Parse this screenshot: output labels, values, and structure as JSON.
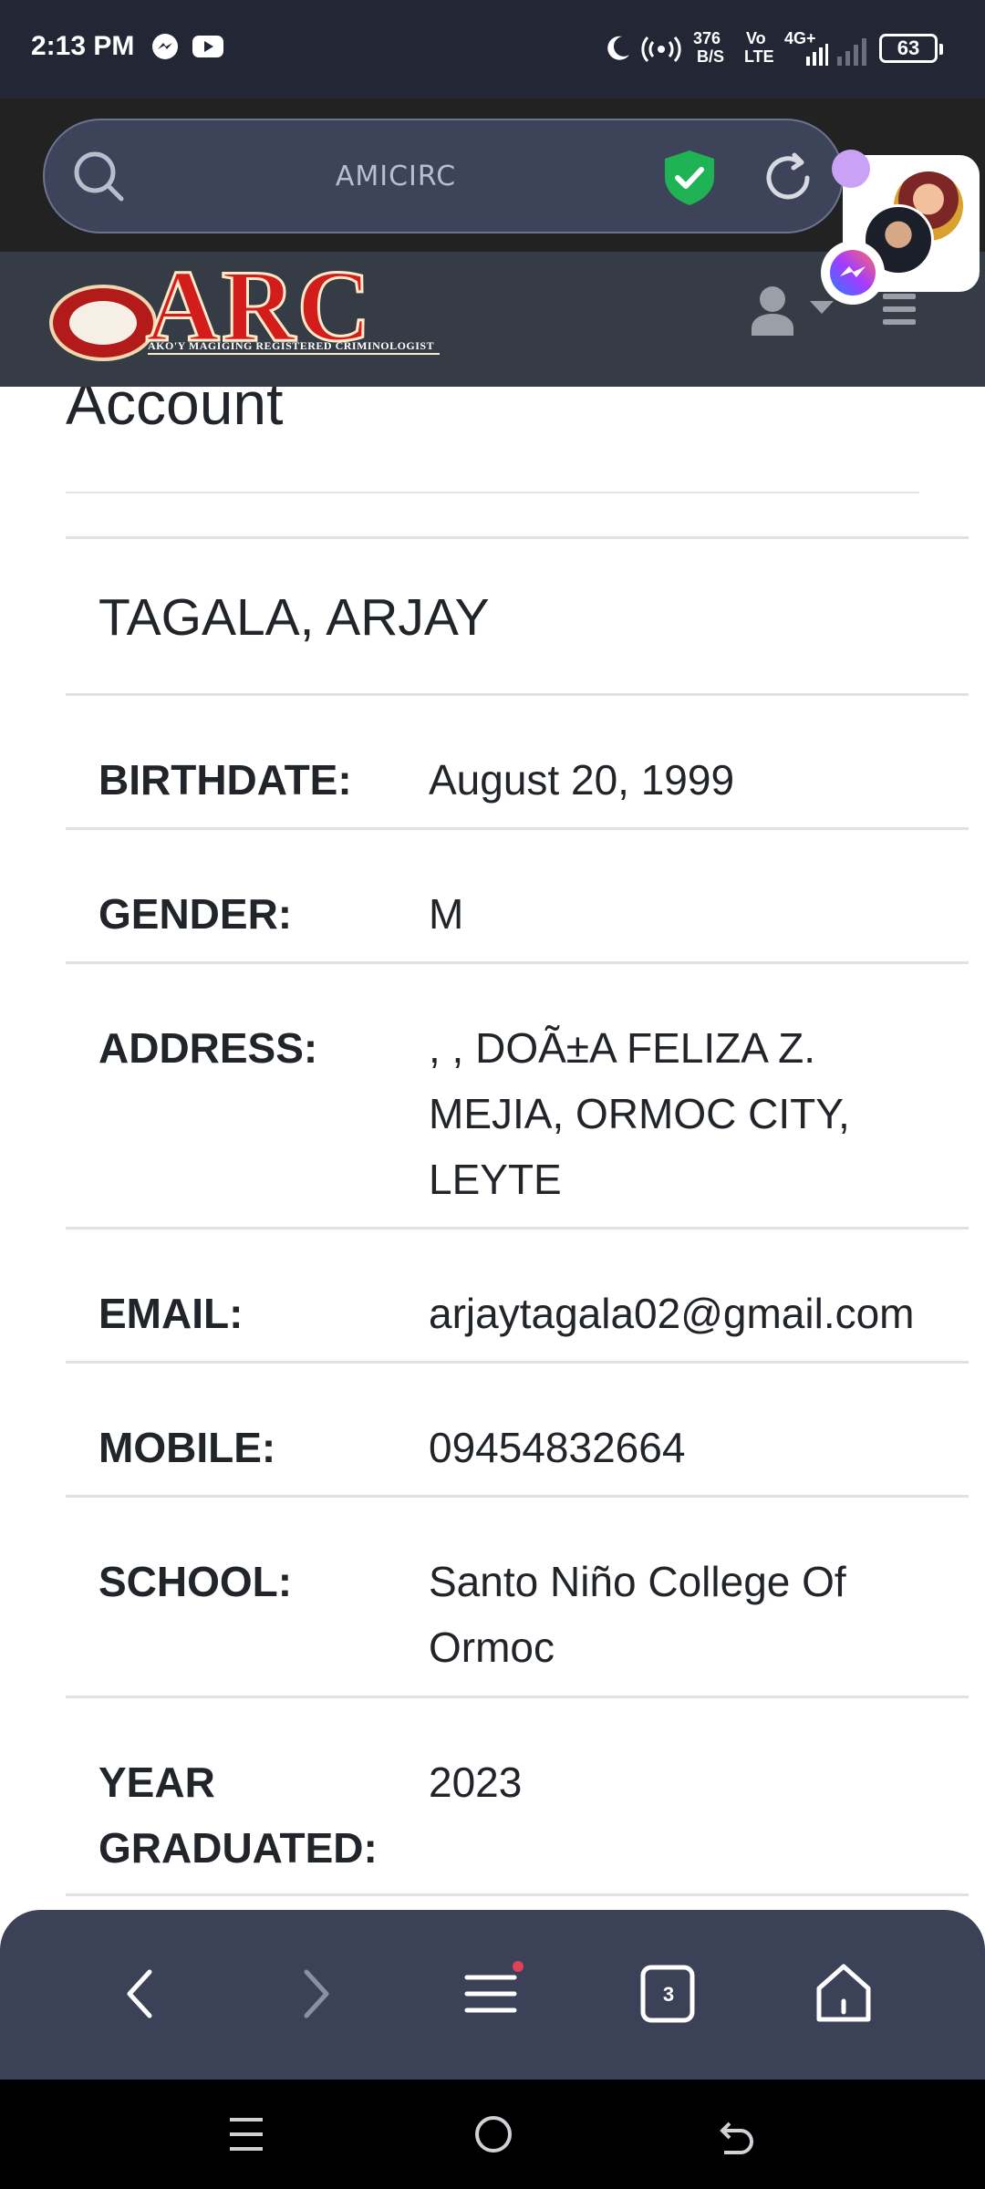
{
  "status_bar": {
    "time": "2:13 PM",
    "net_speed_value": "376",
    "net_speed_unit": "B/S",
    "volte_top": "Vo",
    "volte_bottom": "LTE",
    "network": "4G+",
    "battery": "63"
  },
  "browser": {
    "url": "AMICIRC",
    "tab_count": "3"
  },
  "site": {
    "logo_text": "ARC",
    "logo_tagline": "AKO'Y MAGIGING REGISTERED CRIMINOLOGIST"
  },
  "page": {
    "title": "Account",
    "name": "TAGALA, ARJAY",
    "fields": [
      {
        "label": "BIRTHDATE:",
        "value": "August 20, 1999"
      },
      {
        "label": "GENDER:",
        "value": "M"
      },
      {
        "label": "ADDRESS:",
        "value": ", , DOÃ±A FELIZA Z. MEJIA, ORMOC CITY, LEYTE"
      },
      {
        "label": "EMAIL:",
        "value": "arjaytagala02@gmail.com"
      },
      {
        "label": "MOBILE:",
        "value": "09454832664"
      },
      {
        "label": "SCHOOL:",
        "value": "Santo Niño College Of Ormoc"
      },
      {
        "label": "YEAR GRADUATED:",
        "value": "2023"
      }
    ]
  },
  "colors": {
    "status_bar_bg": "#232635",
    "site_header_bg": "#353c45",
    "logo_red": "#d31c1c",
    "shield_green": "#1fb355",
    "browser_nav_bg": "#3b4157"
  }
}
